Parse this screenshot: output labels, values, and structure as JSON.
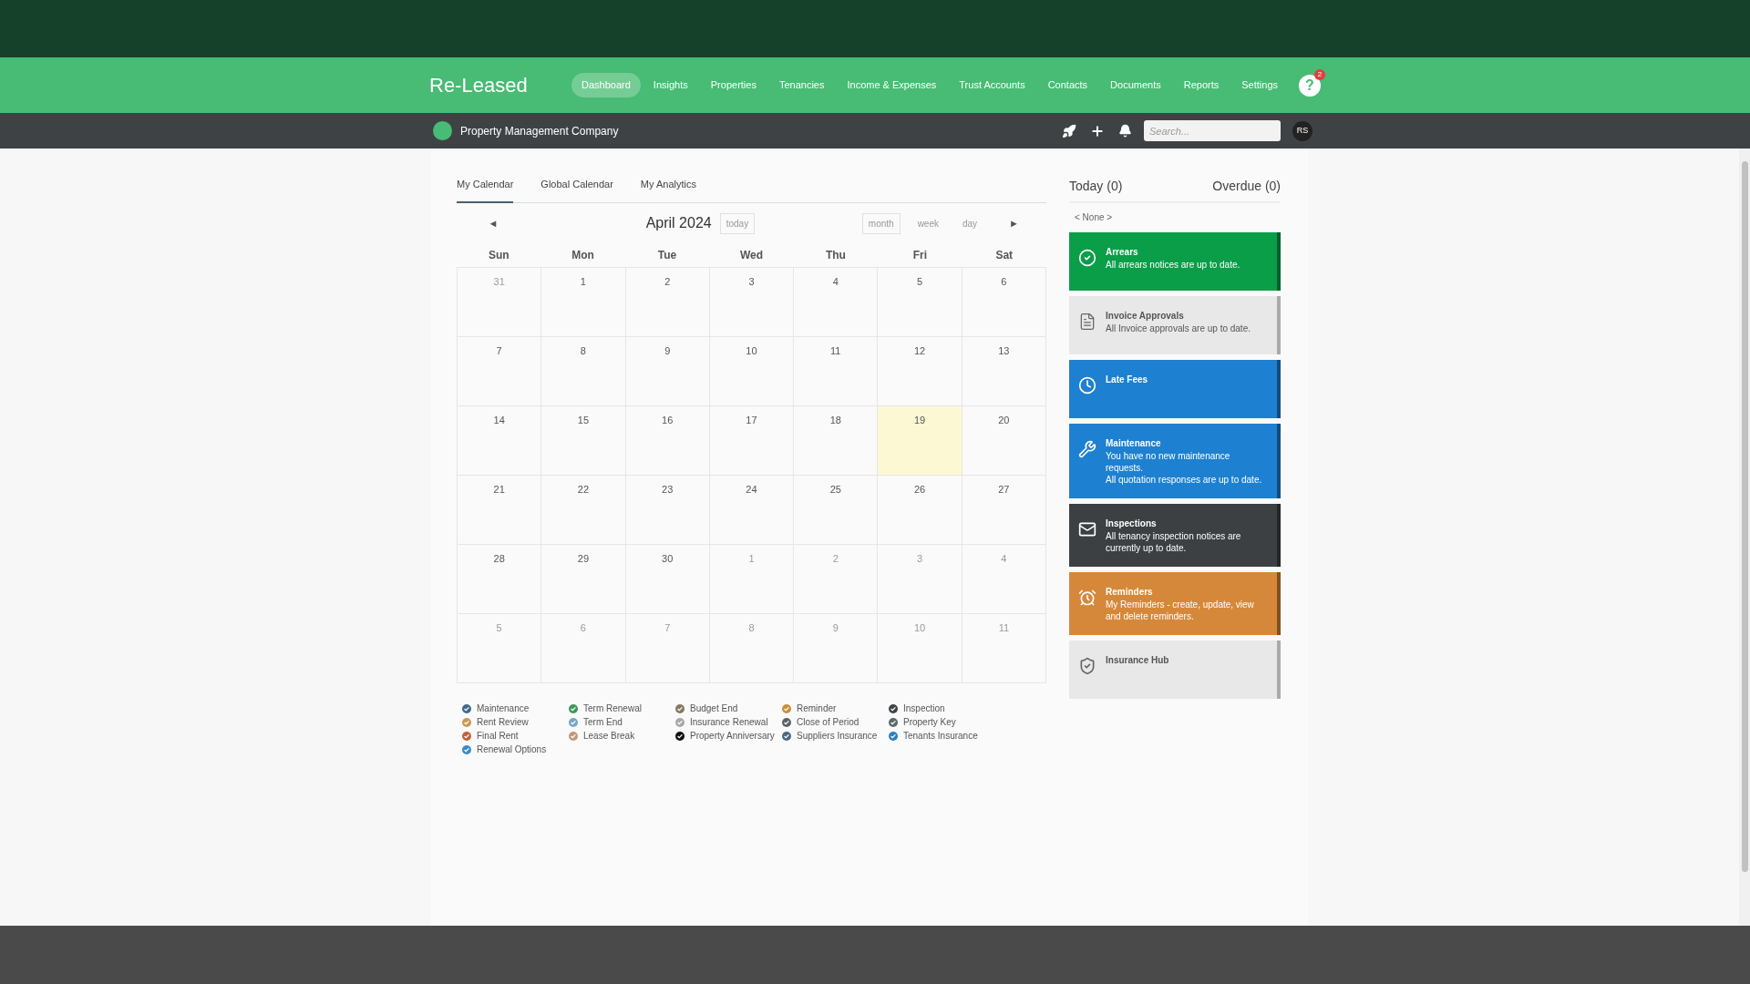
{
  "brand": "Re-Leased",
  "nav": [
    {
      "label": "Dashboard",
      "selected": true
    },
    {
      "label": "Insights",
      "selected": false
    },
    {
      "label": "Properties",
      "selected": false
    },
    {
      "label": "Tenancies",
      "selected": false
    },
    {
      "label": "Income & Expenses",
      "selected": false
    },
    {
      "label": "Trust Accounts",
      "selected": false
    },
    {
      "label": "Contacts",
      "selected": false
    },
    {
      "label": "Documents",
      "selected": false
    },
    {
      "label": "Reports",
      "selected": false
    },
    {
      "label": "Settings",
      "selected": false
    }
  ],
  "help": {
    "icon": "?",
    "badge": "2"
  },
  "company": "Property Management Company",
  "search": {
    "placeholder": "Search..."
  },
  "avatar": "RS",
  "tabs": [
    {
      "label": "My Calendar",
      "selected": true
    },
    {
      "label": "Global Calendar",
      "selected": false
    },
    {
      "label": "My Analytics",
      "selected": false
    }
  ],
  "calendar": {
    "prev": "◄",
    "next": "►",
    "title": "April 2024",
    "today_button": "today",
    "views": [
      {
        "label": "month",
        "selected": true
      },
      {
        "label": "week",
        "selected": false
      },
      {
        "label": "day",
        "selected": false
      }
    ],
    "weekdays": [
      "Sun",
      "Mon",
      "Tue",
      "Wed",
      "Thu",
      "Fri",
      "Sat"
    ],
    "days": [
      {
        "d": "31",
        "other": true,
        "today": false
      },
      {
        "d": "1",
        "other": false,
        "today": false
      },
      {
        "d": "2",
        "other": false,
        "today": false
      },
      {
        "d": "3",
        "other": false,
        "today": false
      },
      {
        "d": "4",
        "other": false,
        "today": false
      },
      {
        "d": "5",
        "other": false,
        "today": false
      },
      {
        "d": "6",
        "other": false,
        "today": false
      },
      {
        "d": "7",
        "other": false,
        "today": false
      },
      {
        "d": "8",
        "other": false,
        "today": false
      },
      {
        "d": "9",
        "other": false,
        "today": false
      },
      {
        "d": "10",
        "other": false,
        "today": false
      },
      {
        "d": "11",
        "other": false,
        "today": false
      },
      {
        "d": "12",
        "other": false,
        "today": false
      },
      {
        "d": "13",
        "other": false,
        "today": false
      },
      {
        "d": "14",
        "other": false,
        "today": false
      },
      {
        "d": "15",
        "other": false,
        "today": false
      },
      {
        "d": "16",
        "other": false,
        "today": false
      },
      {
        "d": "17",
        "other": false,
        "today": false
      },
      {
        "d": "18",
        "other": false,
        "today": false
      },
      {
        "d": "19",
        "other": false,
        "today": true
      },
      {
        "d": "20",
        "other": false,
        "today": false
      },
      {
        "d": "21",
        "other": false,
        "today": false
      },
      {
        "d": "22",
        "other": false,
        "today": false
      },
      {
        "d": "23",
        "other": false,
        "today": false
      },
      {
        "d": "24",
        "other": false,
        "today": false
      },
      {
        "d": "25",
        "other": false,
        "today": false
      },
      {
        "d": "26",
        "other": false,
        "today": false
      },
      {
        "d": "27",
        "other": false,
        "today": false
      },
      {
        "d": "28",
        "other": false,
        "today": false
      },
      {
        "d": "29",
        "other": false,
        "today": false
      },
      {
        "d": "30",
        "other": false,
        "today": false
      },
      {
        "d": "1",
        "other": true,
        "today": false
      },
      {
        "d": "2",
        "other": true,
        "today": false
      },
      {
        "d": "3",
        "other": true,
        "today": false
      },
      {
        "d": "4",
        "other": true,
        "today": false
      },
      {
        "d": "5",
        "other": true,
        "today": false
      },
      {
        "d": "6",
        "other": true,
        "today": false
      },
      {
        "d": "7",
        "other": true,
        "today": false
      },
      {
        "d": "8",
        "other": true,
        "today": false
      },
      {
        "d": "9",
        "other": true,
        "today": false
      },
      {
        "d": "10",
        "other": true,
        "today": false
      },
      {
        "d": "11",
        "other": true,
        "today": false
      }
    ]
  },
  "legend": [
    [
      {
        "label": "Maintenance",
        "color": "#3d6a8a"
      },
      {
        "label": "Rent Review",
        "color": "#c89a5a"
      },
      {
        "label": "Final Rent",
        "color": "#c0603a"
      },
      {
        "label": "Renewal Options",
        "color": "#3a8ac8"
      }
    ],
    [
      {
        "label": "Term Renewal",
        "color": "#3a9a5a"
      },
      {
        "label": "Term End",
        "color": "#7aa6c4"
      },
      {
        "label": "Lease Break",
        "color": "#c09a80"
      }
    ],
    [
      {
        "label": "Budget End",
        "color": "#857a60"
      },
      {
        "label": "Insurance Renewal",
        "color": "#a8a8a8"
      },
      {
        "label": "Property Anniversary",
        "color": "#111111"
      }
    ],
    [
      {
        "label": "Reminder",
        "color": "#c8903a"
      },
      {
        "label": "Close of Period",
        "color": "#5a6268"
      },
      {
        "label": "Suppliers Insurance",
        "color": "#4a6a80"
      }
    ],
    [
      {
        "label": "Inspection",
        "color": "#3e4448"
      },
      {
        "label": "Property Key",
        "color": "#5a6a68"
      },
      {
        "label": "Tenants Insurance",
        "color": "#2a80c0"
      }
    ]
  ],
  "today_tab": "Today (0)",
  "overdue_tab": "Overdue (0)",
  "none": "< None >",
  "cards": [
    {
      "kind": "check",
      "title": "Arrears",
      "lines": [
        "All arrears notices are up to date."
      ],
      "color": "#0a9e48"
    },
    {
      "kind": "document",
      "title": "Invoice Approvals",
      "lines": [
        "All Invoice approvals are up to date."
      ],
      "color": "#e8e8e8"
    },
    {
      "kind": "clock",
      "title": "Late Fees",
      "color": "#1e80d0"
    },
    {
      "kind": "tools",
      "title": "Maintenance",
      "lines": [
        "You have no new maintenance requests.",
        "All quotation responses are up to date."
      ],
      "color": "#1e80d0"
    },
    {
      "kind": "envelope",
      "title": "Inspections",
      "lines": [
        "All tenancy inspection notices are currently up to date."
      ],
      "color": "#3c4043"
    },
    {
      "kind": "alarm",
      "title": "Reminders",
      "lines": [
        "My Reminders - create, update, view and delete reminders."
      ],
      "color": "#d6883a"
    },
    {
      "kind": "shield",
      "title": "Insurance Hub",
      "color": "#e8e8e8"
    }
  ]
}
